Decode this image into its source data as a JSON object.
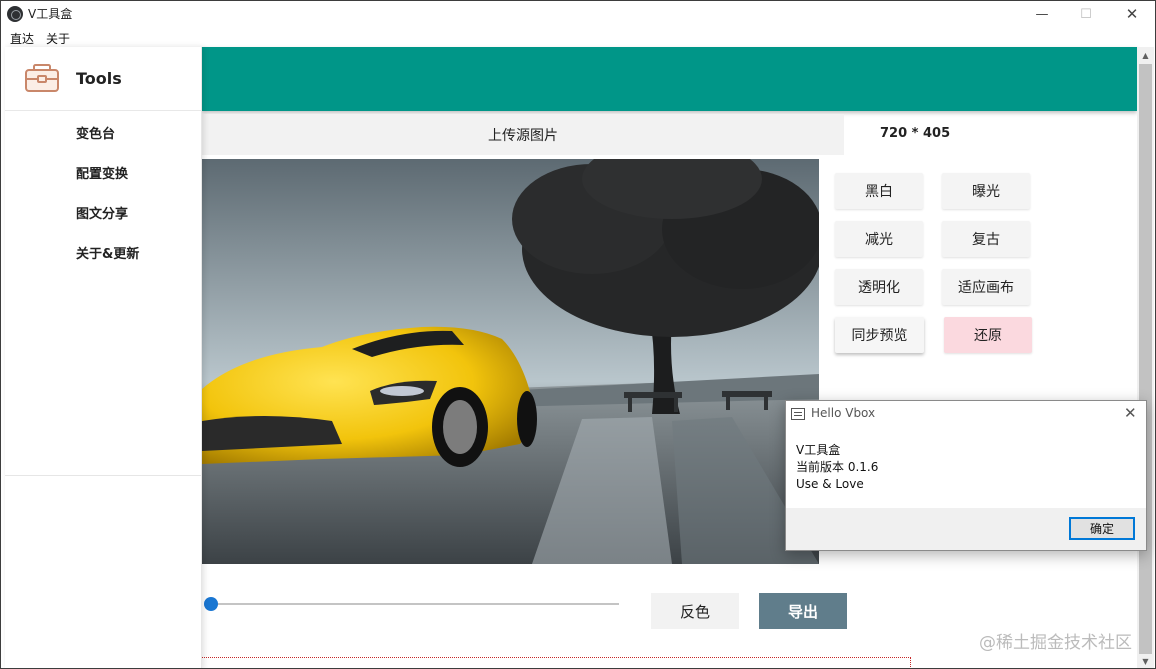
{
  "window": {
    "title": "V工具盒",
    "min_glyph": "—",
    "max_glyph": "☐",
    "close_glyph": "✕"
  },
  "menubar": {
    "items": [
      "直达",
      "关于"
    ]
  },
  "sidebar": {
    "brand": "Tools",
    "brand_icon": "toolbox-icon",
    "items": [
      "变色台",
      "配置变换",
      "图文分享",
      "关于&更新"
    ]
  },
  "main": {
    "header_color": "#009688",
    "upload_label": "上传源图片",
    "dimensions": "720 * 405",
    "filters": [
      "黑白",
      "曝光",
      "减光",
      "复古",
      "透明化",
      "适应画布",
      "同步预览",
      "还原"
    ],
    "slider": {
      "value": 0
    },
    "invert_label": "反色",
    "export_label": "导出"
  },
  "dialog": {
    "title": "Hello Vbox",
    "close_glyph": "✕",
    "lines": [
      "V工具盒",
      "当前版本 0.1.6",
      "Use & Love"
    ],
    "ok_label": "确定"
  },
  "watermark": "@稀土掘金技术社区",
  "colors": {
    "header": "#009688",
    "export_button": "#607d8b",
    "restore_button": "#fbd9df",
    "slider_accent": "#1976d2",
    "dialog_focus": "#0078d7"
  }
}
